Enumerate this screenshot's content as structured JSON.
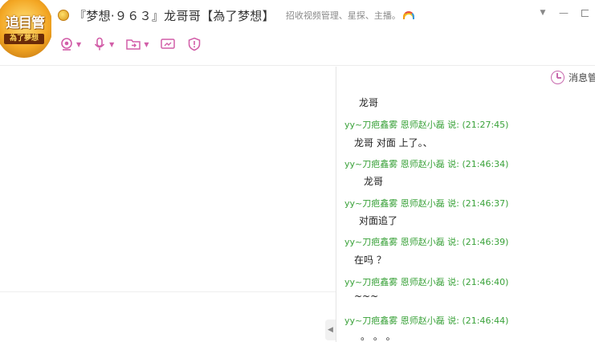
{
  "window": {
    "avatar": {
      "top_text": "追目管",
      "bottom_text": "為了夢想"
    },
    "group_name": "『梦想·９６３』龙哥哥【為了梦想】",
    "group_desc": "招收视频管理、星探、主播。",
    "controls": {
      "menu": "▼",
      "minimize": "—"
    }
  },
  "toolbar": {
    "icons": [
      "camera-icon",
      "microphone-icon",
      "folder-icon",
      "screen-share-icon",
      "shield-icon"
    ],
    "caret": "▼"
  },
  "chat": {
    "manager_label": "消息管",
    "first_text": "龙哥",
    "messages": [
      {
        "sender": "yy~刀疤鑫雾 恩师赵小磊",
        "said": "说:",
        "time": "(21:27:45)",
        "text": "龙哥 对面 上了。、"
      },
      {
        "sender": "yy~刀疤鑫雾 恩师赵小磊",
        "said": "说:",
        "time": "(21:46:34)",
        "text": "龙哥"
      },
      {
        "sender": "yy~刀疤鑫雾 恩师赵小磊",
        "said": "说:",
        "time": "(21:46:37)",
        "text": "对面追了"
      },
      {
        "sender": "yy~刀疤鑫雾 恩师赵小磊",
        "said": "说:",
        "time": "(21:46:39)",
        "text": "在吗 ？"
      },
      {
        "sender": "yy~刀疤鑫雾 恩师赵小磊",
        "said": "说:",
        "time": "(21:46:40)",
        "text": "~~~"
      },
      {
        "sender": "yy~刀疤鑫雾 恩师赵小磊",
        "said": "说:",
        "time": "(21:46:44)",
        "text": "。 。 。"
      }
    ]
  },
  "colors": {
    "accent": "#c86aae",
    "sender": "#3aa23a"
  }
}
